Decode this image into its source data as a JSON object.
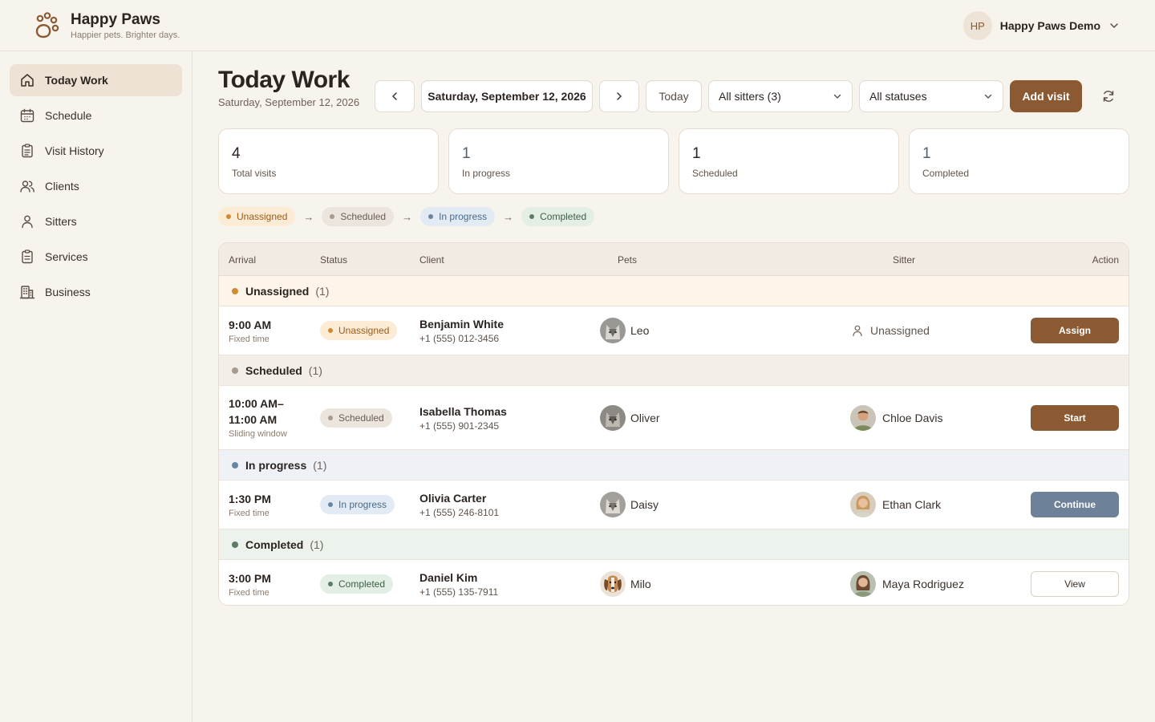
{
  "brand": {
    "name": "Happy Paws",
    "tagline": "Happier pets. Brighter days."
  },
  "account": {
    "initials": "HP",
    "name": "Happy Paws Demo"
  },
  "sidebar": {
    "items": [
      {
        "label": "Today Work",
        "icon": "home-icon",
        "active": true
      },
      {
        "label": "Schedule",
        "icon": "calendar-icon"
      },
      {
        "label": "Visit History",
        "icon": "clipboard-icon"
      },
      {
        "label": "Clients",
        "icon": "users-icon"
      },
      {
        "label": "Sitters",
        "icon": "user-icon"
      },
      {
        "label": "Services",
        "icon": "clipboard-list-icon"
      },
      {
        "label": "Business",
        "icon": "building-icon"
      }
    ]
  },
  "page": {
    "title": "Today Work",
    "subtitle": "Saturday, September 12, 2026"
  },
  "toolbar": {
    "date": "Saturday, September 12, 2026",
    "today_label": "Today",
    "sitters_filter": "All sitters (3)",
    "status_filter": "All statuses",
    "add_label": "Add visit"
  },
  "stats": [
    {
      "value": "4",
      "label": "Total visits"
    },
    {
      "value": "1",
      "label": "In progress"
    },
    {
      "value": "1",
      "label": "Scheduled"
    },
    {
      "value": "1",
      "label": "Completed"
    }
  ],
  "flow": {
    "steps": [
      "Unassigned",
      "Scheduled",
      "In progress",
      "Completed"
    ],
    "arrow": "→"
  },
  "table": {
    "headers": {
      "arrival": "Arrival",
      "status": "Status",
      "client": "Client",
      "pets": "Pets",
      "sitter": "Sitter",
      "action": "Action"
    },
    "groups": [
      {
        "title": "Unassigned",
        "count": "(1)",
        "visit": {
          "time": "9:00 AM",
          "time_type": "Fixed time",
          "status": "Unassigned",
          "client": "Benjamin White",
          "phone": "+1 (555) 012-3456",
          "pet": "Leo",
          "sitter": "Unassigned",
          "action": "Assign"
        }
      },
      {
        "title": "Scheduled",
        "count": "(1)",
        "visit": {
          "time": "10:00 AM–11:00 AM",
          "time_type": "Sliding window",
          "status": "Scheduled",
          "client": "Isabella Thomas",
          "phone": "+1 (555) 901-2345",
          "pet": "Oliver",
          "sitter": "Chloe Davis",
          "action": "Start"
        }
      },
      {
        "title": "In progress",
        "count": "(1)",
        "visit": {
          "time": "1:30 PM",
          "time_type": "Fixed time",
          "status": "In progress",
          "client": "Olivia Carter",
          "phone": "+1 (555) 246-8101",
          "pet": "Daisy",
          "sitter": "Ethan Clark",
          "action": "Continue"
        }
      },
      {
        "title": "Completed",
        "count": "(1)",
        "visit": {
          "time": "3:00 PM",
          "time_type": "Fixed time",
          "status": "Completed",
          "client": "Daniel Kim",
          "phone": "+1 (555) 135-7911",
          "pet": "Milo",
          "sitter": "Maya Rodriguez",
          "action": "View"
        }
      }
    ]
  },
  "colors": {
    "brand": "#8b5a33",
    "background": "#f7f3ed",
    "unassigned": "#d08a34",
    "scheduled": "#a89a8d",
    "in_progress": "#6786a4",
    "completed": "#5d7c63"
  }
}
